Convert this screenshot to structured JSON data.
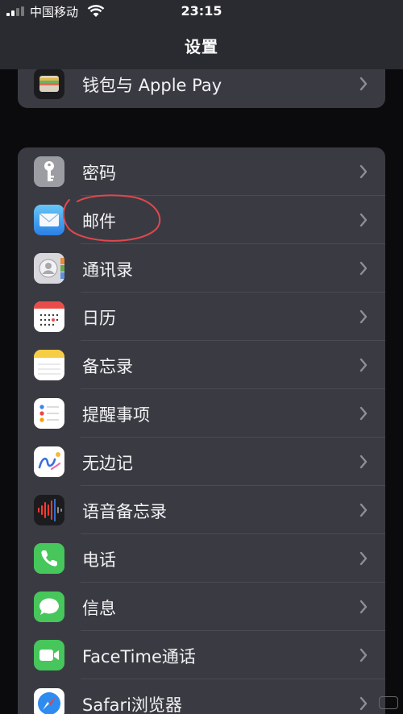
{
  "status_bar": {
    "carrier": "中国移动",
    "time": "23:15"
  },
  "nav": {
    "title": "设置"
  },
  "group_top": [
    {
      "label": "钱包与 Apple Pay",
      "icon": "wallet-icon"
    }
  ],
  "group_main": [
    {
      "label": "密码",
      "icon": "key-icon"
    },
    {
      "label": "邮件",
      "icon": "mail-icon"
    },
    {
      "label": "通讯录",
      "icon": "contacts-icon"
    },
    {
      "label": "日历",
      "icon": "calendar-icon"
    },
    {
      "label": "备忘录",
      "icon": "notes-icon"
    },
    {
      "label": "提醒事项",
      "icon": "reminders-icon"
    },
    {
      "label": "无边记",
      "icon": "freeform-icon"
    },
    {
      "label": "语音备忘录",
      "icon": "voice-memos-icon"
    },
    {
      "label": "电话",
      "icon": "phone-icon"
    },
    {
      "label": "信息",
      "icon": "messages-icon"
    },
    {
      "label": "FaceTime通话",
      "icon": "facetime-icon"
    },
    {
      "label": "Safari浏览器",
      "icon": "safari-icon"
    }
  ],
  "colors": {
    "background": "#0b0b0d",
    "group": "#3a3b42",
    "annotation": "#e0474f"
  }
}
